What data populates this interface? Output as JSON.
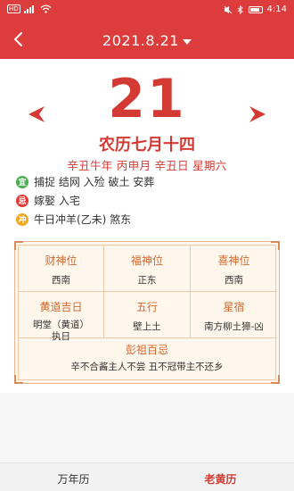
{
  "status": {
    "left_label": "HD",
    "time": "4:14"
  },
  "header": {
    "date_title": "2021.8.21"
  },
  "day": {
    "number": "21",
    "lunar": "农历七月十四",
    "ganzhi": "辛丑牛年 丙申月 辛丑日 星期六"
  },
  "yiji": [
    {
      "badge": "宜",
      "text": "捕捉 结网 入殓 破土 安葬",
      "color": "#4caf50"
    },
    {
      "badge": "忌",
      "text": "嫁娶 入宅",
      "color": "#e53935"
    },
    {
      "badge": "冲",
      "text": "牛日冲羊(乙未) 煞东",
      "color": "#f0a81e"
    }
  ],
  "info_grid": [
    {
      "title": "财神位",
      "value": "西南"
    },
    {
      "title": "福神位",
      "value": "正东"
    },
    {
      "title": "喜神位",
      "value": "西南"
    },
    {
      "title": "黄道吉日",
      "value": "明堂（黄道）",
      "value2": "执日"
    },
    {
      "title": "五行",
      "value": "壁上土"
    },
    {
      "title": "星宿",
      "value": "南方柳土獐-凶"
    }
  ],
  "pengzu": {
    "title": "彭祖百忌",
    "text": "辛不合酱主人不尝 丑不冠带主不还乡"
  },
  "tabs": [
    {
      "label": "万年历",
      "active": false
    },
    {
      "label": "老黄历",
      "active": true
    }
  ],
  "colors": {
    "header": "#dc3c3c",
    "accent": "#d43a34",
    "card_bg": "#fff6ec"
  }
}
